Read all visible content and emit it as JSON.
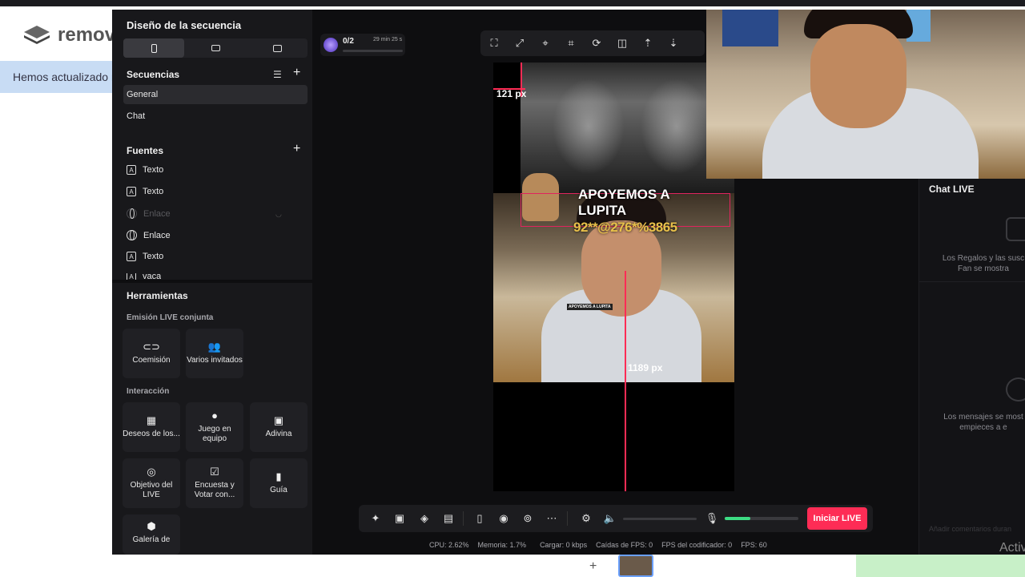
{
  "background": {
    "logo_text": "remov",
    "banner": "Hemos actualizado n"
  },
  "left_panel": {
    "title": "Diseño de la secuencia",
    "sequences": {
      "heading": "Secuencias",
      "items": [
        "General",
        "Chat"
      ]
    },
    "sources": {
      "heading": "Fuentes",
      "items": [
        {
          "label": "Texto",
          "icon": "text-icon",
          "dim": false
        },
        {
          "label": "Texto",
          "icon": "text-icon",
          "dim": false
        },
        {
          "label": "Enlace",
          "icon": "globe-icon",
          "dim": true
        },
        {
          "label": "Enlace",
          "icon": "globe-icon",
          "dim": false
        },
        {
          "label": "Texto",
          "icon": "text-icon",
          "dim": false
        },
        {
          "label": "vaca",
          "icon": "text-icon",
          "dim": false
        }
      ]
    },
    "tools": {
      "heading": "Herramientas",
      "group1_label": "Emisión LIVE conjunta",
      "group1": [
        "Coemisión",
        "Varios invitados"
      ],
      "group2_label": "Interacción",
      "group2": [
        "Deseos de los...",
        "Juego en equipo",
        "Adivina",
        "Objetivo del LIVE",
        "Encuesta y Votar con...",
        "Guía",
        "Galería de"
      ]
    }
  },
  "top_widget": {
    "counter": "0/2",
    "time": "29 min 25 s"
  },
  "preview": {
    "top_px": "121 px",
    "bottom_px": "1189 px",
    "headline": "APOYEMOS A LUPITA",
    "code": "92**@276*%3865",
    "small_tag": "APOYEMOS A LUPITA"
  },
  "chat": {
    "title": "Chat LIVE",
    "gifts_msg": "Los Regalos y las susc Fan se mostra",
    "messages_msg": "Los mensajes se most empieces a e",
    "input_placeholder": "Añadir comentarios duran"
  },
  "controls": {
    "live_button": "Iniciar LIVE",
    "mic_level": 0.35
  },
  "stats": {
    "cpu": "CPU: 2.62%",
    "memory": "Memoria: 1.7%",
    "upload": "Cargar: 0 kbps",
    "fps_drops": "Caídas de FPS: 0",
    "encoder_fps": "FPS del codificador: 0",
    "fps": "FPS: 60"
  },
  "watermark": "Activ",
  "colors": {
    "accent": "#fe2c55",
    "panel": "#18181b",
    "canvas_bg": "#0e0e10"
  }
}
